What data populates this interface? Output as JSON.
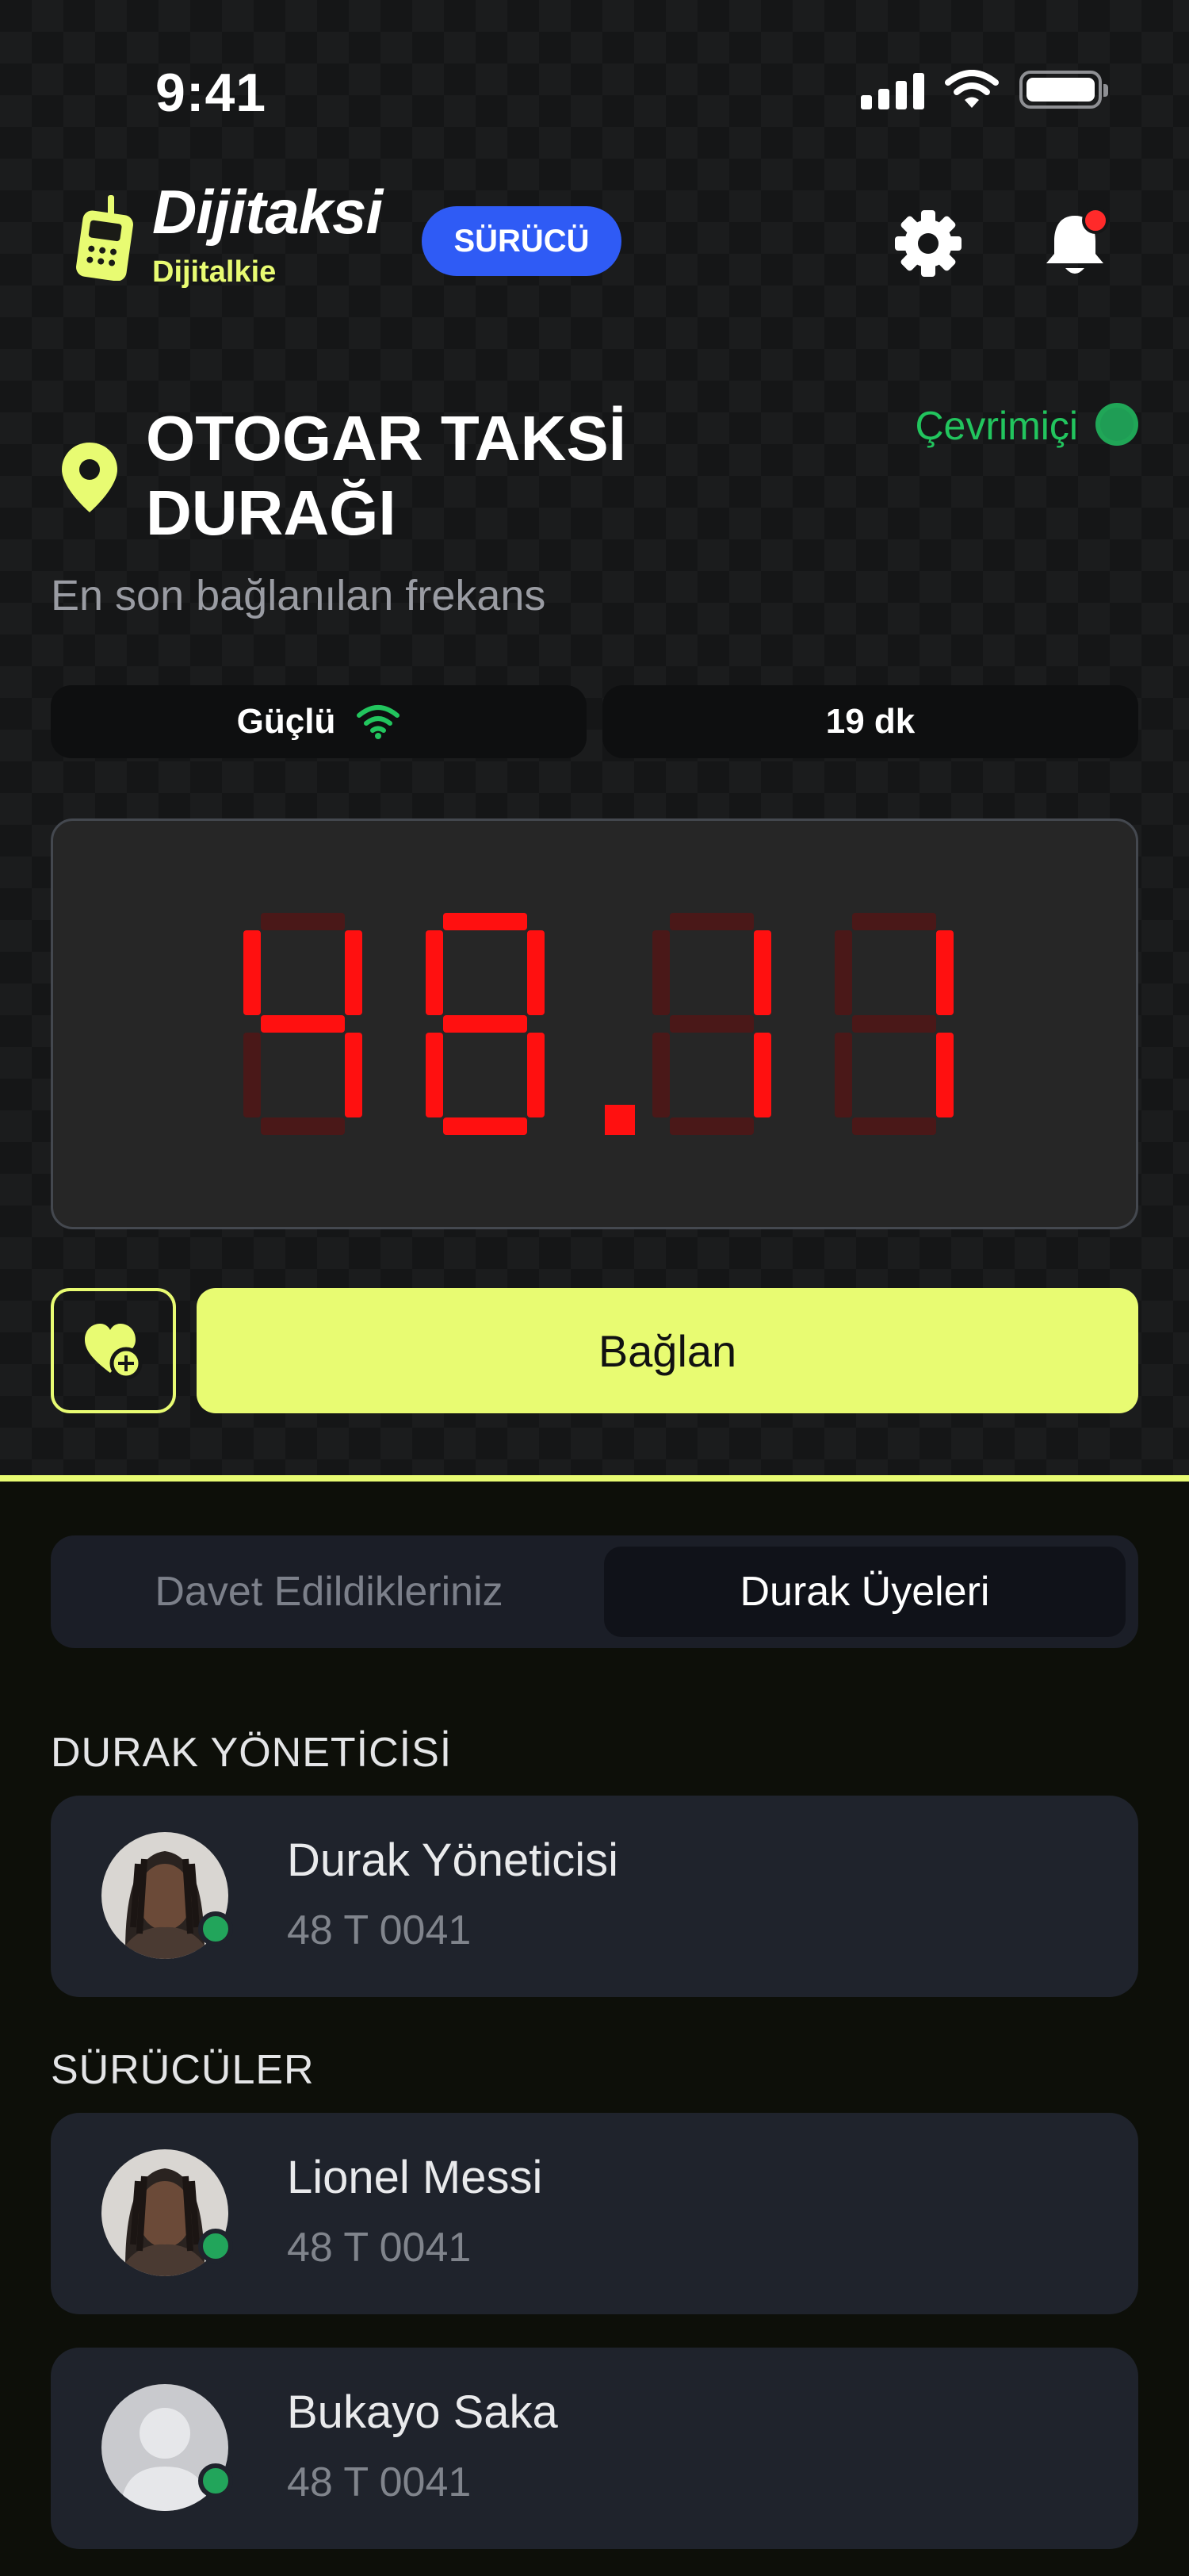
{
  "status_bar": {
    "time": "9:41"
  },
  "header": {
    "brand": "Dijitaksi",
    "sub_brand": "Dijitalkie",
    "role_badge": "SÜRÜCÜ"
  },
  "station": {
    "title": "OTOGAR TAKSİ DURAĞI",
    "status": "Çevrimiçi",
    "subtitle": "En son bağlanılan frekans"
  },
  "info_pills": {
    "signal": "Güçlü",
    "duration": "19 dk"
  },
  "frequency": {
    "value": "48.11"
  },
  "actions": {
    "connect_label": "Bağlan"
  },
  "tabs": [
    {
      "label": "Davet Edildikleriniz",
      "active": false
    },
    {
      "label": "Durak Üyeleri",
      "active": true
    }
  ],
  "sections": {
    "manager_title": "DURAK YÖNETİCİSİ",
    "drivers_title": "SÜRÜCÜLER"
  },
  "manager": {
    "name": "Durak Yöneticisi",
    "code": "48 T 0041",
    "online": true
  },
  "drivers": [
    {
      "name": "Lionel Messi",
      "code": "48 T 0041",
      "online": true
    },
    {
      "name": "Bukayo Saka",
      "code": "48 T 0041",
      "online": true
    }
  ],
  "colors": {
    "accent": "#e8fb72",
    "badge": "#2f5bf5",
    "online": "#22c55e",
    "segment_on": "#ff1010",
    "segment_off": "#4a1818"
  }
}
